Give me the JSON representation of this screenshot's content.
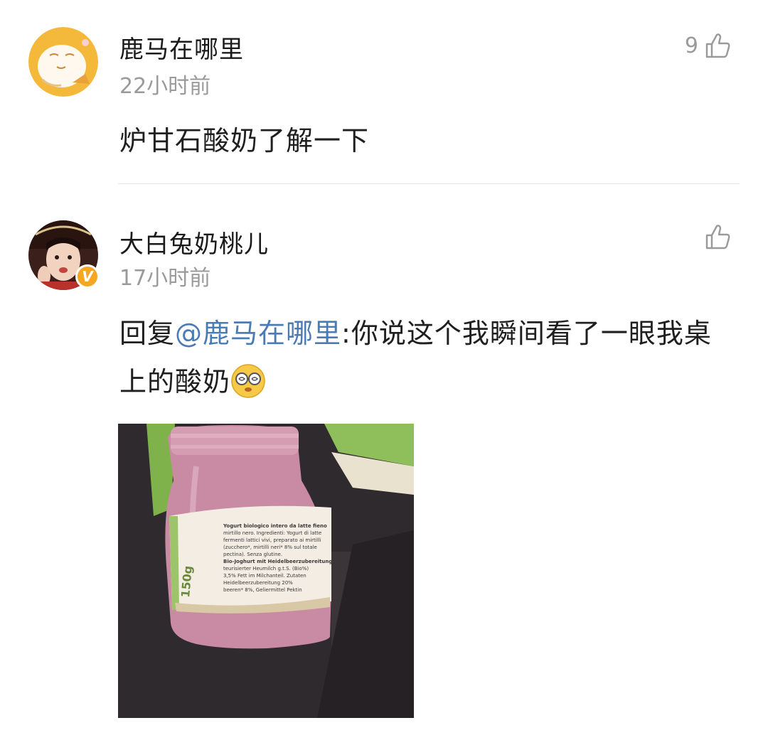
{
  "comments": [
    {
      "username": "鹿马在哪里",
      "time": "22小时前",
      "likes": "9",
      "text": "炉甘石酸奶了解一下"
    },
    {
      "username": "大白兔奶桃儿",
      "time": "17小时前",
      "likes": "",
      "verified_badge": "V",
      "reply_prefix": "回复",
      "mention": "@鹿马在哪里",
      "text": ":你说这个我瞬间看了一眼我桌上的酸奶",
      "emoji": "dizzy-glasses-emoji",
      "image_alt": "photo of a jar of pink blueberry yogurt",
      "photo_label": {
        "line1": "Yogurt biologico intero da latte fieno",
        "line2": "mirtillo nero. Ingredienti: Yogurt di latte",
        "line3": "fermenti lattici vivi, preparato ai mirtilli",
        "line4": "(zucchero*, mirtilli neri* 8% sul totale",
        "line5": "pectina). Senza glutine.",
        "line6": "Bio-Joghurt mit Heidelbeerzubereitung",
        "line7": "teurisierter Heumilch g.t.S. (Bio%)",
        "line8": "3,5% Fett im Milchanteil. Zutaten",
        "line9": "Heidelbeerzubereitung 20%",
        "line10": "beeren* 8%, Geliermittel Pektin",
        "weight": "150g"
      }
    }
  ],
  "colors": {
    "username": "#1a1a1a",
    "timestamp": "#9a9a9a",
    "mention": "#4a7bb5",
    "badge": "#f5a623",
    "divider": "#e6e6e6"
  }
}
